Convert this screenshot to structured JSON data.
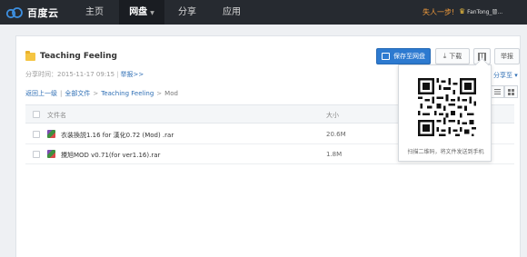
{
  "topbar": {
    "logo_text": "百度云",
    "nav": [
      {
        "label": "主页",
        "active": false
      },
      {
        "label": "网盘",
        "active": true
      },
      {
        "label": "分享",
        "active": false
      },
      {
        "label": "应用",
        "active": false
      }
    ],
    "promo": "失人一步!",
    "user": "FanTong_晉..."
  },
  "share": {
    "folder_name": "Teaching Feeling",
    "meta_time": "分享时间：2015-11-17 09:15",
    "report_link": "举报>>",
    "save_label": "保存至网盘",
    "download_label": "下载",
    "report_label": "举报",
    "share_more": "分享至",
    "back_link": "返回上一级",
    "all_files": "全部文件",
    "crumb_folder": "Teaching Feeling",
    "crumb_current": "Mod"
  },
  "table": {
    "col_name": "文件名",
    "col_size": "大小",
    "rows": [
      {
        "name": "衣装換説1.16 for 漢化0.72 (Mod) .rar",
        "size": "20.6M"
      },
      {
        "name": "攪旭MOD v0.71(for ver1.16).rar",
        "size": "1.8M"
      }
    ]
  },
  "qr": {
    "caption": "扫描二维码，将文件发送到手机"
  },
  "colors": {
    "topbar_bg": "#262a30",
    "accent_blue": "#2d7ad0",
    "promo_orange": "#f39c3c"
  }
}
